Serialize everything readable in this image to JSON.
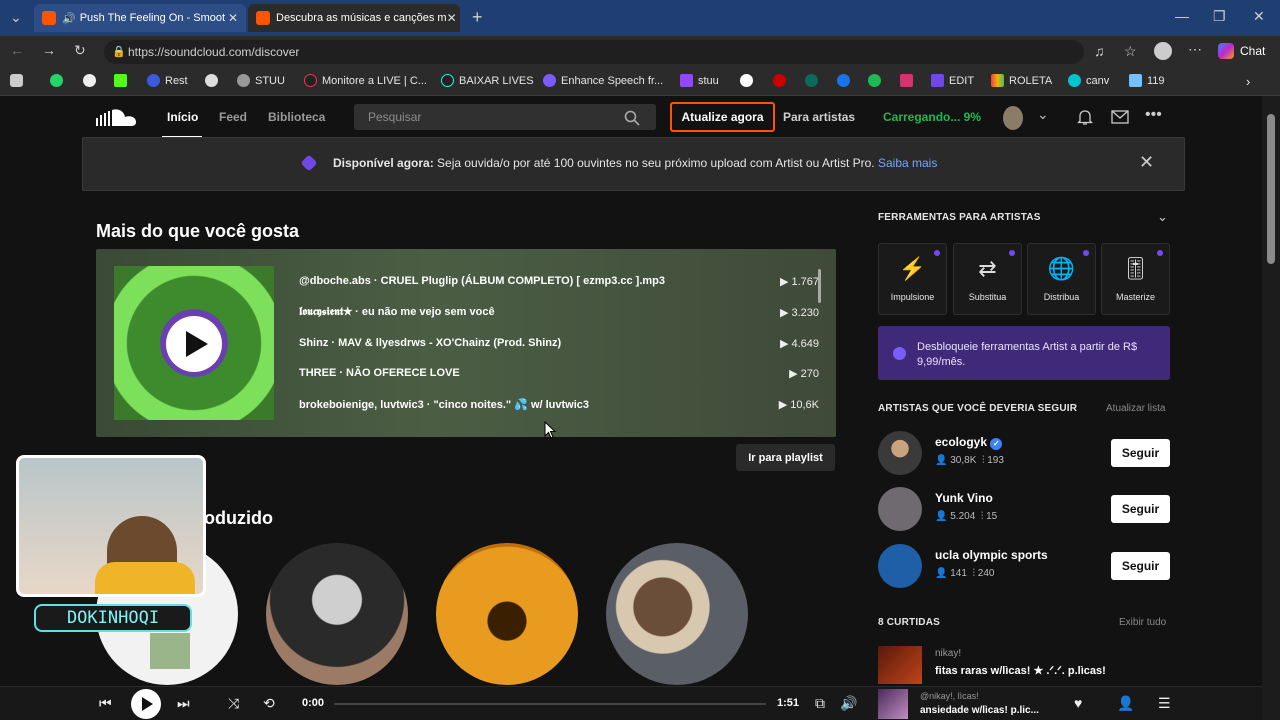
{
  "tabs": [
    {
      "title": "Push The Feeling On - Smoot",
      "active": false
    },
    {
      "title": "Descubra as músicas e canções m",
      "active": true
    }
  ],
  "address": {
    "url": "https://soundcloud.com/discover"
  },
  "browser": {
    "chat_label": "Chat"
  },
  "bookmarks": [
    "Rest",
    "STUU",
    "Monitore a LIVE | C...",
    "BAIXAR LIVES",
    "Enhance Speech fr...",
    "stuu",
    "EDIT",
    "ROLETA",
    "canv",
    "119"
  ],
  "header": {
    "nav": [
      "Início",
      "Feed",
      "Biblioteca"
    ],
    "search_placeholder": "Pesquisar",
    "upgrade": "Atualize agora",
    "for_artists": "Para artistas",
    "loading": "Carregando... 9%"
  },
  "banner": {
    "bold": "Disponível agora:",
    "text": "Seja ouvida/o por até 100 ouvintes no seu próximo upload com Artist ou Artist Pro.",
    "link": "Saiba mais"
  },
  "section1": {
    "title": "Mais do que você gosta",
    "tracks": [
      {
        "title": "@dboche.abs · CRUEL Pluglip (ÁLBUM COMPLETO) [ ezmp3.cc ].mp3",
        "plays": "1.767"
      },
      {
        "title": "𝖑𝖔𝖚𝖈𝖞𝖘𝖎𝖊𝖓𝖙★ · eu não me vejo sem você",
        "plays": "3.230"
      },
      {
        "title": "Shinz · MAV & llyesdrws - XO'Chainz (Prod. Shinz)",
        "plays": "4.649"
      },
      {
        "title": "THREE · NÃO OFERECE LOVE",
        "plays": "270"
      },
      {
        "title": "brokeboienige, luvtwic3 · \"cinco noites.\" 💦 w/ luvtwic3",
        "plays": "10,6K"
      }
    ],
    "go_playlist": "Ir para playlist"
  },
  "section2": {
    "title_partial": "oduzido"
  },
  "streamer": {
    "overlay_name": "DOKINHOQI"
  },
  "sidebar": {
    "tools_title": "FERRAMENTAS PARA ARTISTAS",
    "tools": [
      "Impulsione",
      "Substitua",
      "Distribua",
      "Masterize"
    ],
    "unlock": "Desbloqueie ferramentas Artist a partir de R$ 9,99/mês.",
    "follow_title": "ARTISTAS QUE VOCÊ DEVERIA SEGUIR",
    "refresh": "Atualizar lista",
    "artists": [
      {
        "name": "ecologyk",
        "followers": "30,8K",
        "tracks": "193"
      },
      {
        "name": "Yunk Vino",
        "followers": "5.204",
        "tracks": "15"
      },
      {
        "name": "ucla olympic sports",
        "followers": "141",
        "tracks": "240"
      }
    ],
    "follow_label": "Seguir",
    "likes_title": "8 CURTIDAS",
    "view_all": "Exibir tudo",
    "liked": {
      "user": "nikay!",
      "title": "fitas raras w/lìcas! ★ .ᐟ.ᐟ. p.lìcas!"
    }
  },
  "player": {
    "current": "0:00",
    "duration": "1:51",
    "now_user": "@nikay!, lìcas!",
    "now_title": "ansiedade w/lìcas! p.lic..."
  }
}
